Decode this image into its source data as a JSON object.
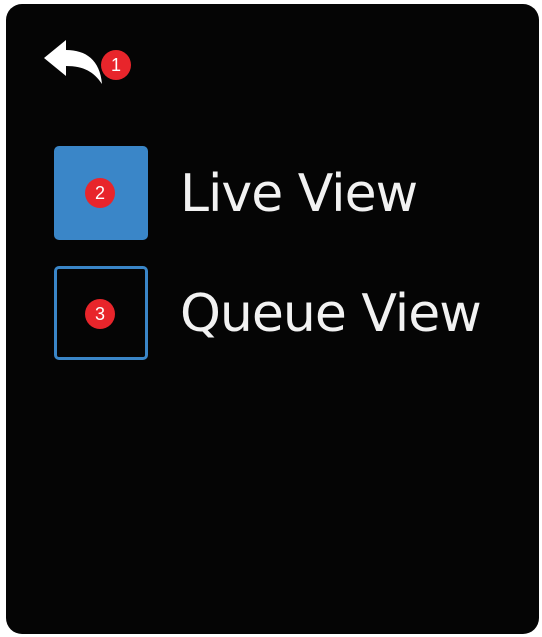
{
  "colors": {
    "background": "#050505",
    "accent": "#3a86c8",
    "text": "#f2f2f2",
    "marker": "#e8252b"
  },
  "header": {
    "back_icon": "back-arrow-icon"
  },
  "options": [
    {
      "label": "Live View",
      "checked": true
    },
    {
      "label": "Queue View",
      "checked": false
    }
  ],
  "markers": [
    "1",
    "2",
    "3"
  ]
}
